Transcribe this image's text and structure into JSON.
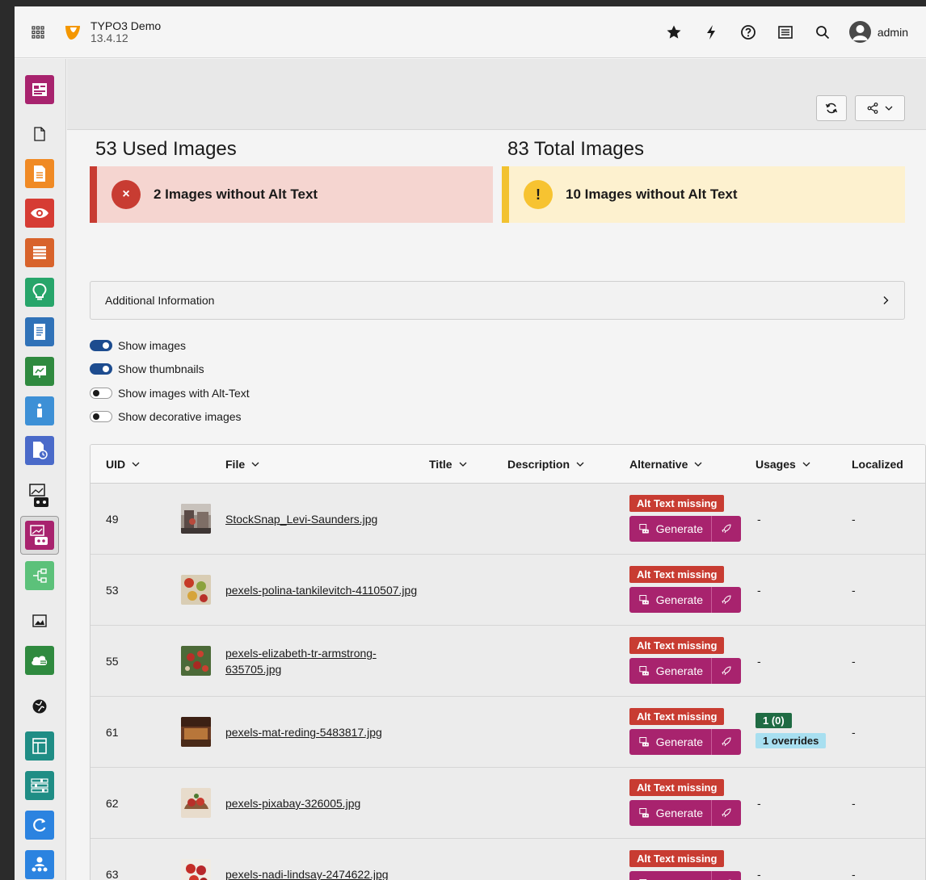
{
  "brand": {
    "name": "TYPO3 Demo",
    "version": "13.4.12"
  },
  "topbar": {
    "user": "admin",
    "icons": [
      "star-icon",
      "flash-icon",
      "help-icon",
      "list-icon",
      "search-icon"
    ]
  },
  "colors": {
    "accent": "#a8236e",
    "danger": "#c83c32",
    "warning": "#f7c331",
    "success": "#1f6b43",
    "info": "#a8dff0",
    "toggle_on": "#1d4c8f"
  },
  "stats": {
    "used": {
      "title": "53 Used Images",
      "message": "2 Images without Alt Text",
      "icon": "×"
    },
    "total": {
      "title": "83 Total Images",
      "message": "10 Images without Alt Text",
      "icon": "!"
    }
  },
  "additional_info": {
    "label": "Additional Information"
  },
  "toggles": [
    {
      "label": "Show images",
      "on": true
    },
    {
      "label": "Show thumbnails",
      "on": true
    },
    {
      "label": "Show images with Alt-Text",
      "on": false
    },
    {
      "label": "Show decorative images",
      "on": false
    }
  ],
  "table": {
    "headers": {
      "uid": "UID",
      "file": "File",
      "title": "Title",
      "description": "Description",
      "alternative": "Alternative",
      "usages": "Usages",
      "localized": "Localized"
    },
    "missing_label": "Alt Text missing",
    "generate_label": "Generate",
    "rows": [
      {
        "uid": "49",
        "file": "StockSnap_Levi-Saunders.jpg",
        "usage": "-",
        "localized": "-"
      },
      {
        "uid": "53",
        "file": "pexels-polina-tankilevitch-4110507.jpg",
        "usage": "-",
        "localized": "-"
      },
      {
        "uid": "55",
        "file": "pexels-elizabeth-tr-armstrong-635705.jpg",
        "usage": "-",
        "localized": "-"
      },
      {
        "uid": "61",
        "file": "pexels-mat-reding-5483817.jpg",
        "usage_count": "1 (0)",
        "usage_overrides": "1 overrides",
        "localized": "-"
      },
      {
        "uid": "62",
        "file": "pexels-pixabay-326005.jpg",
        "usage": "-",
        "localized": "-"
      },
      {
        "uid": "63",
        "file": "pexels-nadi-lindsay-2474622.jpg",
        "usage": "-",
        "localized": "-"
      }
    ]
  }
}
